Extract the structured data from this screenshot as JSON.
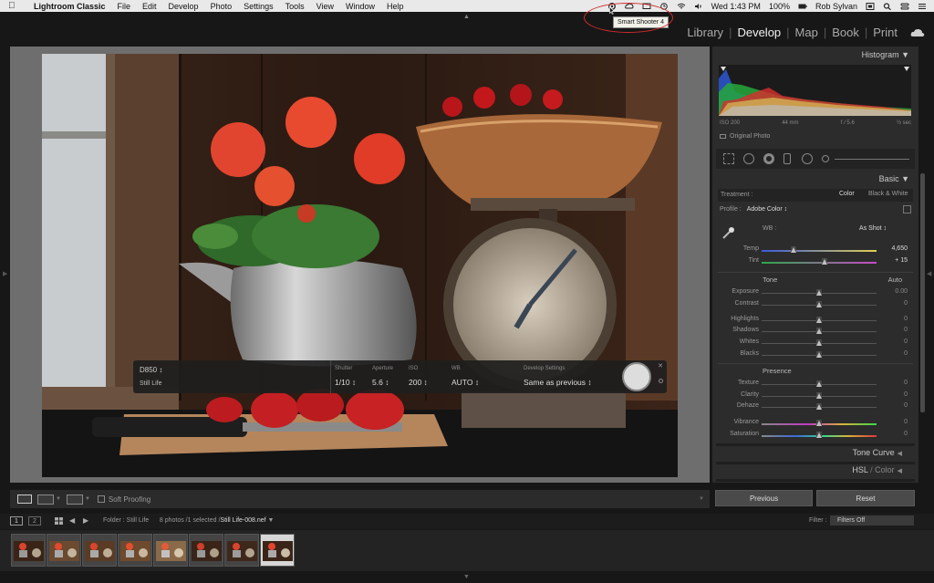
{
  "menubar": {
    "app": "Lightroom Classic",
    "items": [
      "File",
      "Edit",
      "Develop",
      "Photo",
      "Settings",
      "Tools",
      "View",
      "Window",
      "Help"
    ],
    "clock": "Wed 1:43 PM",
    "battery": "100%",
    "user": "Rob Sylvan"
  },
  "tooltip": "Smart Shooter 4",
  "modules": [
    "Library",
    "Develop",
    "Map",
    "Book",
    "Print"
  ],
  "active_module": "Develop",
  "hud": {
    "camera": "D850",
    "session": "Still Life",
    "shutter_label": "Shutter",
    "shutter": "1/10",
    "aperture_label": "Aperture",
    "aperture": "5.6",
    "iso_label": "ISO",
    "iso": "200",
    "wb_label": "WB",
    "wb": "AUTO",
    "dev_label": "Develop Settings",
    "dev": "Same as previous"
  },
  "toolbar": {
    "soft_proofing": "Soft Proofing"
  },
  "histogram": {
    "title": "Histogram",
    "iso": "ISO 200",
    "focal": "44 mm",
    "aperture": "f / 5.6",
    "shutter": "½ sec",
    "original": "Original Photo"
  },
  "basic": {
    "title": "Basic",
    "treatment_label": "Treatment :",
    "color": "Color",
    "bw": "Black & White",
    "profile_label": "Profile :",
    "profile_value": "Adobe Color",
    "wb_label": "WB :",
    "wb_value": "As Shot",
    "temp_label": "Temp",
    "temp_value": "4,650",
    "tint_label": "Tint",
    "tint_value": "+ 15",
    "tone_label": "Tone",
    "auto": "Auto",
    "exposure_label": "Exposure",
    "exposure_value": "0.00",
    "contrast_label": "Contrast",
    "contrast_value": "0",
    "highlights_label": "Highlights",
    "highlights_value": "0",
    "shadows_label": "Shadows",
    "shadows_value": "0",
    "whites_label": "Whites",
    "whites_value": "0",
    "blacks_label": "Blacks",
    "blacks_value": "0",
    "presence_label": "Presence",
    "texture_label": "Texture",
    "texture_value": "0",
    "clarity_label": "Clarity",
    "clarity_value": "0",
    "dehaze_label": "Dehaze",
    "dehaze_value": "0",
    "vibrance_label": "Vibrance",
    "vibrance_value": "0",
    "saturation_label": "Saturation",
    "saturation_value": "0"
  },
  "panels": {
    "tone_curve": "Tone Curve",
    "hsl": "HSL",
    "hsl_sep": " / ",
    "hsl_color": "Color"
  },
  "buttons": {
    "previous": "Previous",
    "reset": "Reset"
  },
  "filmstrip": {
    "page1": "1",
    "page2": "2",
    "folder": "Folder : Still Life",
    "count": "8 photos /1 selected /",
    "file": "Still Life-008.nef",
    "filter_label": "Filter :",
    "filter_value": "Filters Off"
  }
}
